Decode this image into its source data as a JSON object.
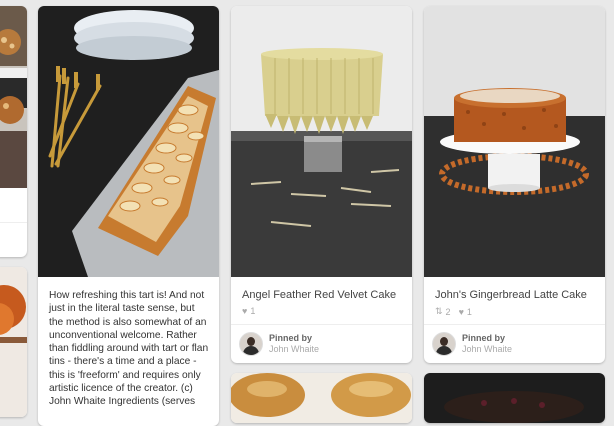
{
  "pins": [
    {
      "description": "How refreshing this tart is! And not just in the literal taste sense, but the method is also somewhat of an unconventional welcome. Rather than fiddling around with tart or flan tins - there's a time and a place - this is 'freeform' and requires only artistic licence of the creator.  (c) John Whaite Ingredients (serves"
    },
    {
      "title": "Angel Feather Red Velvet Cake",
      "likes": "1",
      "pinned_by_label": "Pinned by",
      "pinner": "John Whaite"
    },
    {
      "title": "John's Gingerbread Latte Cake",
      "repins": "2",
      "likes": "1",
      "pinned_by_label": "Pinned by",
      "pinner": "John Whaite"
    }
  ],
  "icons": {
    "repin": "repin-icon",
    "like": "heart-icon"
  },
  "colors": {
    "background": "#e9e9e9",
    "card": "#ffffff"
  }
}
